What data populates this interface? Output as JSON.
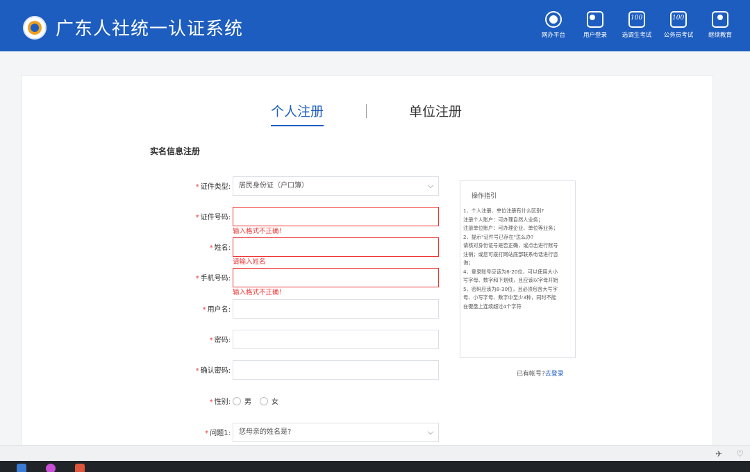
{
  "header": {
    "title": "广东人社统一认证系统",
    "nav": [
      {
        "label": "网办平台",
        "icon": "portal-icon"
      },
      {
        "label": "用户登录",
        "icon": "user-login-icon"
      },
      {
        "label": "选调生考试",
        "icon": "exam-icon"
      },
      {
        "label": "公务员考试",
        "icon": "exam-icon"
      },
      {
        "label": "继续教育",
        "icon": "education-icon"
      }
    ]
  },
  "tabs": {
    "personal": "个人注册",
    "organization": "单位注册"
  },
  "section_title": "实名信息注册",
  "form": {
    "id_type": {
      "label": "证件类型:",
      "value": "居民身份证（户口簿）"
    },
    "id_number": {
      "label": "证件号码:",
      "value": "",
      "error": "输入格式不正确！"
    },
    "name": {
      "label": "姓名:",
      "value": "",
      "error": "请输入姓名"
    },
    "phone": {
      "label": "手机号码:",
      "value": "",
      "error": "输入格式不正确！"
    },
    "username": {
      "label": "用户名:",
      "value": ""
    },
    "password": {
      "label": "密码:",
      "value": ""
    },
    "confirm_password": {
      "label": "确认密码:",
      "value": ""
    },
    "gender": {
      "label": "性别:",
      "male": "男",
      "female": "女"
    },
    "question1": {
      "label": "问题1:",
      "value": "您母亲的姓名是?"
    },
    "required_mark": "*"
  },
  "guide": {
    "title": "操作指引",
    "lines": [
      "1、个人注册、单位注册有什么区别?",
      "注册个人账户：可办理自然人业务；",
      "注册单位账户：可办理企业、单位等业务；",
      "2、提示\"证件号已存在\"怎么办?",
      "请核对身份证号是否正确，或点击进行账号",
      "注销；或您可拨打网站底部联系电话进行咨",
      "询；",
      "4、登录账号应该为6-20位，可以使用大小",
      "写字母、数字和下划线，且应该以字母开始",
      "5、密码应该为8-30位，且必须包含大写字",
      "母、小写字母、数字中至少3种，同时不能",
      "在键盘上连续超过4个字符"
    ]
  },
  "login_prompt": {
    "text": "已有帐号?",
    "link": "去登录"
  },
  "colors": {
    "brand": "#1d5dbf",
    "error": "#e33333"
  }
}
